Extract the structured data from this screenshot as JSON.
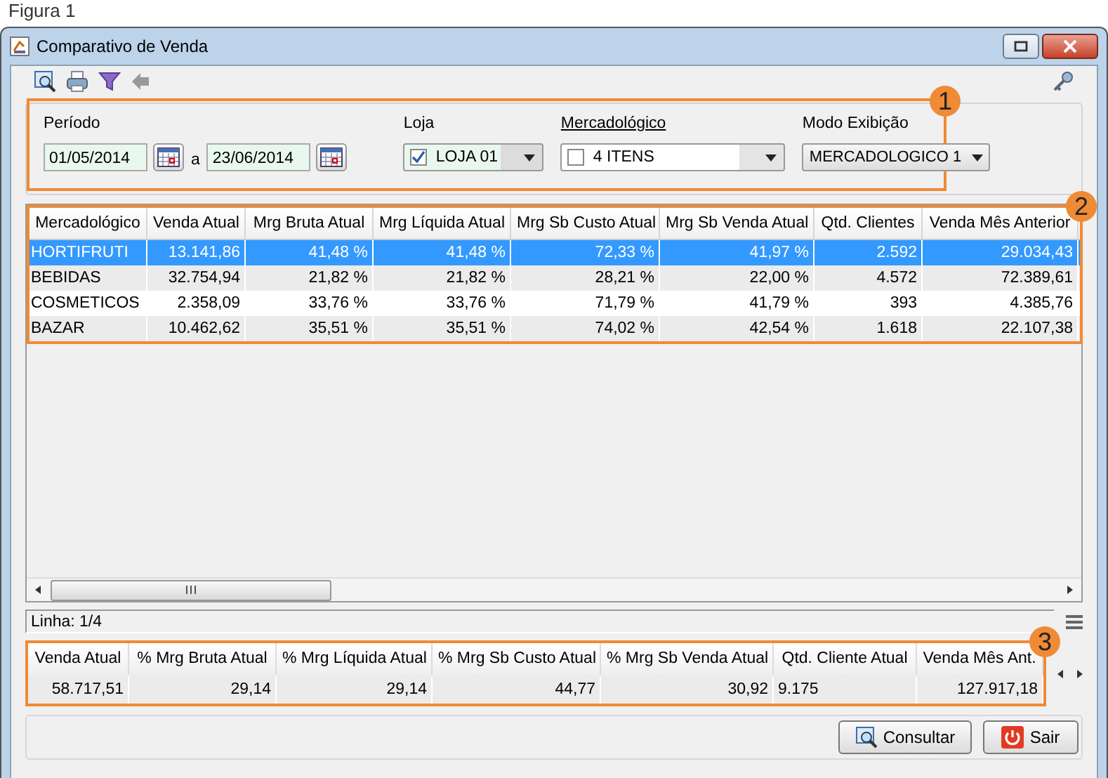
{
  "caption": "Figura 1",
  "window": {
    "title": "Comparativo de Venda"
  },
  "filters": {
    "period": {
      "label": "Período",
      "from": "01/05/2014",
      "separator": "a",
      "to": "23/06/2014"
    },
    "store": {
      "label": "Loja",
      "value": "LOJA 01",
      "checked": true
    },
    "category": {
      "label": "Mercadológico",
      "value": "4 ITENS",
      "checked": false
    },
    "mode": {
      "label": "Modo Exibição",
      "value": "MERCADOLOGICO 1"
    }
  },
  "grid": {
    "columns": [
      "Mercadológico",
      "Venda Atual",
      "Mrg Bruta Atual",
      "Mrg Líquida Atual",
      "Mrg Sb Custo Atual",
      "Mrg Sb Venda Atual",
      "Qtd. Clientes",
      "Venda Mês Anterior"
    ],
    "rows": [
      {
        "selected": true,
        "cells": [
          "HORTIFRUTI",
          "13.141,86",
          "41,48 %",
          "41,48 %",
          "72,33 %",
          "41,97 %",
          "2.592",
          "29.034,43"
        ]
      },
      {
        "selected": false,
        "cells": [
          "BEBIDAS",
          "32.754,94",
          "21,82 %",
          "21,82 %",
          "28,21 %",
          "22,00 %",
          "4.572",
          "72.389,61"
        ]
      },
      {
        "selected": false,
        "cells": [
          "COSMETICOS",
          "2.358,09",
          "33,76 %",
          "33,76 %",
          "71,79 %",
          "41,79 %",
          "393",
          "4.385,76"
        ]
      },
      {
        "selected": false,
        "cells": [
          "BAZAR",
          "10.462,62",
          "35,51 %",
          "35,51 %",
          "74,02 %",
          "42,54 %",
          "1.618",
          "22.107,38"
        ]
      }
    ]
  },
  "status": "Linha: 1/4",
  "totals": {
    "columns": [
      "Venda Atual",
      "% Mrg Bruta Atual",
      "% Mrg Líquida Atual",
      "% Mrg Sb Custo Atual",
      "% Mrg Sb Venda Atual",
      "Qtd. Cliente Atual",
      "Venda Mês Ant."
    ],
    "values": [
      "58.717,51",
      "29,14",
      "29,14",
      "44,77",
      "30,92",
      "9.175",
      "127.917,18"
    ]
  },
  "buttons": [
    {
      "label": "Consultar",
      "kind": "search"
    },
    {
      "label": "Sair",
      "kind": "exit"
    }
  ],
  "callouts": [
    "1",
    "2",
    "3"
  ]
}
